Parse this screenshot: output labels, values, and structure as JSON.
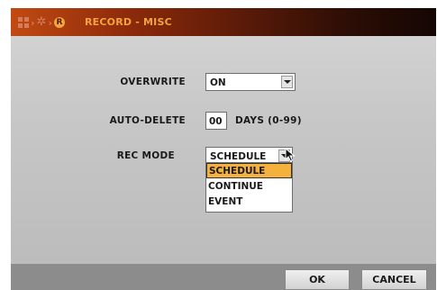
{
  "titlebar": {
    "title": "RECORD - MISC",
    "icons": [
      "grid-icon",
      "chevron-right-icon",
      "gear-icon",
      "chevron-right-icon",
      "record-icon"
    ],
    "rec_glyph": "R",
    "separator": "›"
  },
  "form": {
    "overwrite": {
      "label": "OVERWRITE",
      "value": "ON"
    },
    "auto_delete": {
      "label": "AUTO-DELETE",
      "value": "00",
      "unit": "DAYS (0-99)"
    },
    "rec_mode": {
      "label": "REC MODE",
      "value": "SCHEDULE",
      "options": [
        "SCHEDULE",
        "CONTINUE",
        "EVENT"
      ],
      "highlighted": "SCHEDULE"
    }
  },
  "footer": {
    "ok": "OK",
    "cancel": "CANCEL"
  },
  "colors": {
    "accent": "#f2a340",
    "highlight": "#f4b13e",
    "title_bg_start": "#c24a12",
    "title_bg_end": "#150603"
  }
}
